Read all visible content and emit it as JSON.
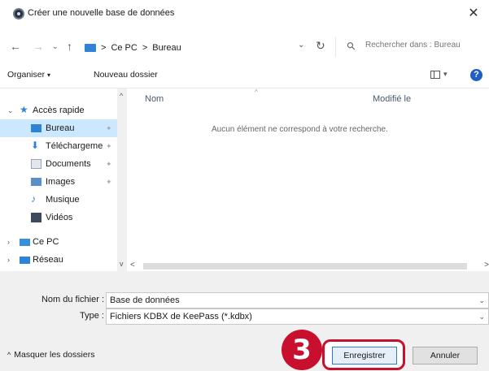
{
  "window": {
    "title": "Créer une nouvelle base de données"
  },
  "nav": {
    "breadcrumb": [
      "Ce PC",
      "Bureau"
    ],
    "separator": ">",
    "search_placeholder": "Rechercher dans : Bureau"
  },
  "toolbar": {
    "organize": "Organiser",
    "new_folder": "Nouveau dossier"
  },
  "sidebar": {
    "items": [
      {
        "label": "Accès rapide"
      },
      {
        "label": "Bureau"
      },
      {
        "label": "Téléchargeme"
      },
      {
        "label": "Documents"
      },
      {
        "label": "Images"
      },
      {
        "label": "Musique"
      },
      {
        "label": "Vidéos"
      },
      {
        "label": "Ce PC"
      },
      {
        "label": "Réseau"
      }
    ]
  },
  "list": {
    "columns": [
      "Nom",
      "Modifié le"
    ],
    "empty_message": "Aucun élément ne correspond à votre recherche."
  },
  "form": {
    "filename_label": "Nom du fichier :",
    "filename_value": "Base de données",
    "type_label": "Type :",
    "type_value": "Fichiers KDBX de KeePass (*.kdbx)"
  },
  "footer": {
    "hide_folders": "Masquer les dossiers"
  },
  "buttons": {
    "save": "Enregistrer",
    "cancel": "Annuler"
  },
  "annotation": {
    "step": "3"
  },
  "colors": {
    "accent": "#c8102e",
    "selection": "#cce8ff",
    "folder": "#2f83d6"
  },
  "icons": [
    "app-icon",
    "close-icon",
    "back-arrow-icon",
    "forward-arrow-icon",
    "up-arrow-icon",
    "refresh-icon",
    "search-icon",
    "view-icon",
    "help-icon",
    "star-icon",
    "desktop-folder-icon",
    "download-icon",
    "documents-icon",
    "images-icon",
    "music-icon",
    "videos-icon",
    "computer-icon",
    "network-icon",
    "pin-icon"
  ]
}
